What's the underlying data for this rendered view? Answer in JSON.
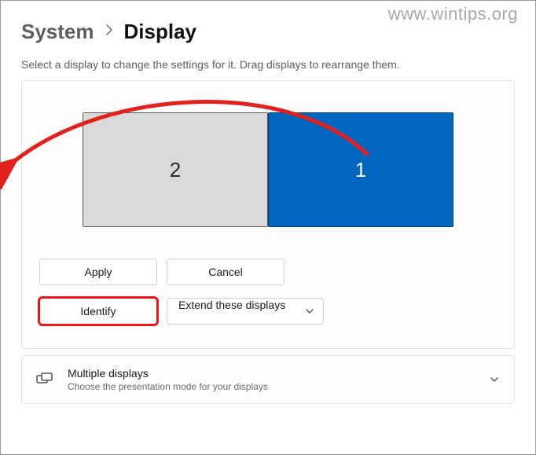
{
  "watermark": "www.wintips.org",
  "breadcrumb": {
    "parent": "System",
    "current": "Display"
  },
  "instruction": "Select a display to change the settings for it. Drag displays to rearrange them.",
  "monitors": {
    "left_label": "2",
    "right_label": "1"
  },
  "buttons": {
    "apply": "Apply",
    "cancel": "Cancel",
    "identify": "Identify"
  },
  "projection_select": {
    "selected": "Extend these displays"
  },
  "expander": {
    "title": "Multiple displays",
    "subtitle": "Choose the presentation mode for your displays"
  },
  "colors": {
    "accent": "#0067c0",
    "highlight": "#ef1313"
  }
}
